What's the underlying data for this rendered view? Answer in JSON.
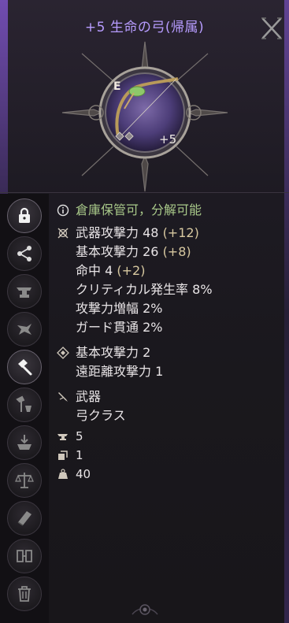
{
  "item": {
    "title": "+5 生命の弓(帰属)",
    "badge_grade": "E",
    "enhance": "+5"
  },
  "stats": {
    "storage_note": "倉庫保管可，分解可能",
    "weapon_attack_label": "武器攻撃力",
    "weapon_attack_value": "48",
    "weapon_attack_bonus": "(+12)",
    "base_attack_label": "基本攻撃力",
    "base_attack_value": "26",
    "base_attack_bonus": "(+8)",
    "accuracy_label": "命中",
    "accuracy_value": "4",
    "accuracy_bonus": "(+2)",
    "crit_label": "クリティカル発生率",
    "crit_value": "8%",
    "attack_amp_label": "攻撃力増幅",
    "attack_amp_value": "2%",
    "guard_pierce_label": "ガード貫通",
    "guard_pierce_value": "2%",
    "extra_base_attack_label": "基本攻撃力",
    "extra_base_attack_value": "2",
    "ranged_attack_label": "遠距離攻撃力",
    "ranged_attack_value": "1",
    "category": "武器",
    "class": "弓クラス",
    "anvil_count": "5",
    "stack_count": "1",
    "weight": "40"
  },
  "sidebar": {
    "buttons": [
      "lock-icon",
      "share-icon",
      "anvil-icon",
      "enchant-icon",
      "hammer-icon",
      "craft-icon",
      "deposit-icon",
      "scales-icon",
      "book-icon",
      "compare-icon",
      "trash-icon"
    ]
  },
  "colors": {
    "title": "#b79cff",
    "green_note": "#a9c98a",
    "bonus": "#d7c8a0"
  }
}
